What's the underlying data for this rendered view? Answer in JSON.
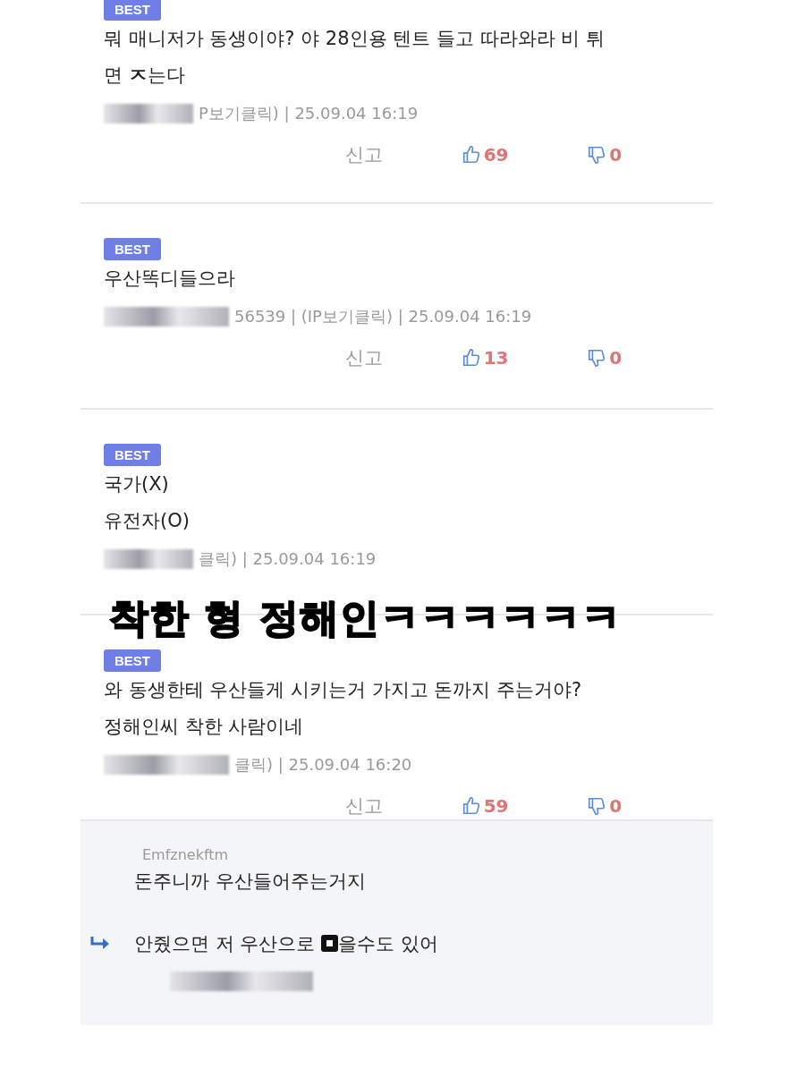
{
  "comments": [
    {
      "badge": "BEST",
      "lines": [
        "뭐 매니저가 동생이야? 야 28인용 텐트 들고 따라와라 비 튀",
        "면 **ㅈ**는다"
      ],
      "meta": "P보기클릭) | 25.09.04 16:19",
      "report": "신고",
      "likes": "69",
      "dislikes": "0"
    },
    {
      "badge": "BEST",
      "lines": [
        "우산똑디들으라"
      ],
      "meta": "56539 | (IP보기클릭) | 25.09.04 16:19",
      "report": "신고",
      "likes": "13",
      "dislikes": "0"
    },
    {
      "badge": "BEST",
      "lines": [
        "국가(X)",
        "유전자(O)"
      ],
      "meta": "클릭) | 25.09.04 16:19"
    },
    {
      "badge": "BEST",
      "lines": [
        "와 동생한테 우산들게 시키는거 가지고 돈까지 주는거야?",
        "정해인씨 착한 사람이네"
      ],
      "meta": "클릭) | 25.09.04 16:20",
      "report": "신고",
      "likes": "59",
      "dislikes": "0"
    }
  ],
  "caption": "착한 형 정해인ㅋㅋㅋㅋㅋㅋ",
  "replies": [
    {
      "author": "Emfznekftm",
      "text": "돈주니까 우산들어주는거지"
    },
    {
      "text_before": "안줬으면 저 우산으로 ",
      "text_after": "을수도 있어"
    }
  ]
}
